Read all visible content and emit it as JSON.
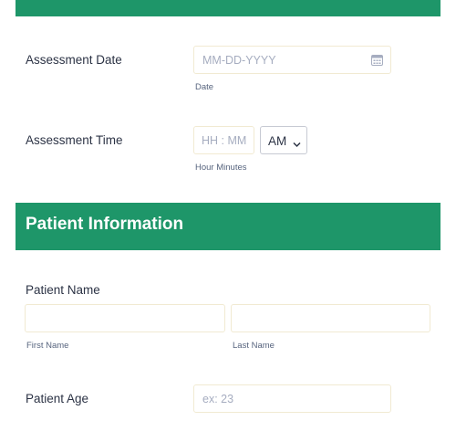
{
  "assessment_date": {
    "label": "Assessment Date",
    "placeholder": "MM-DD-YYYY",
    "sublabel": "Date",
    "icon": "calendar-icon"
  },
  "assessment_time": {
    "label": "Assessment Time",
    "placeholder": "HH : MM",
    "ampm_value": "AM",
    "sublabel": "Hour Minutes",
    "icon": "chevron-down-icon"
  },
  "section": {
    "title": "Patient Information",
    "color": "#1e9669"
  },
  "patient_name": {
    "label": "Patient Name",
    "first_sublabel": "First Name",
    "last_sublabel": "Last Name"
  },
  "patient_age": {
    "label": "Patient Age",
    "placeholder": "ex: 23"
  }
}
